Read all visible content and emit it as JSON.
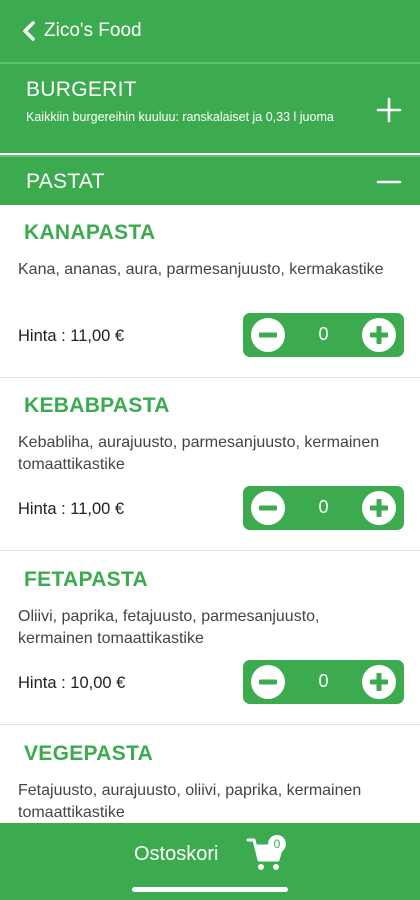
{
  "header": {
    "title": "Zico's Food",
    "back_icon": "chevron-left-icon"
  },
  "categories": {
    "burgerit": {
      "title": "BURGERIT",
      "description": "Kaikkiin burgereihin kuuluu: ranskalaiset ja 0,33 l juoma",
      "toggle_icon": "plus-icon",
      "expanded": false
    },
    "pastat": {
      "title": "PASTAT",
      "toggle_icon": "minus-icon",
      "expanded": true
    }
  },
  "items": [
    {
      "name": "KANAPASTA",
      "description": "Kana, ananas, aura, parmesanjuusto, kermakastike",
      "price": "Hinta : 11,00 €",
      "quantity": "0"
    },
    {
      "name": "KEBABPASTA",
      "description": "Kebabliha, aurajuusto, parmesanjuusto, kermainen tomaattikastike",
      "price": "Hinta : 11,00 €",
      "quantity": "0"
    },
    {
      "name": "FETAPASTA",
      "description": "Oliivi, paprika, fetajuusto, parmesanjuusto, kermainen tomaattikastike",
      "price": "Hinta : 10,00 €",
      "quantity": "0"
    },
    {
      "name": "VEGEPASTA",
      "description": "Fetajuusto, aurajuusto, oliivi, paprika, kermainen tomaattikastike"
    }
  ],
  "cart": {
    "label": "Ostoskori",
    "count": "0",
    "icon": "cart-icon"
  },
  "colors": {
    "accent": "#3cab4f",
    "background": "#ffffff"
  }
}
